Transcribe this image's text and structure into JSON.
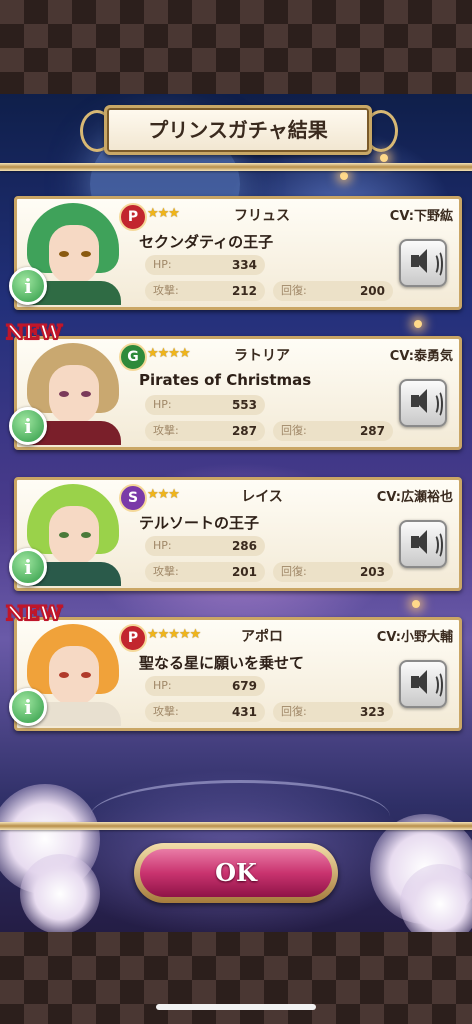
{
  "header": {
    "title": "プリンスガチャ結果"
  },
  "cards": [
    {
      "name": "フリュス",
      "cv": "CV:下野紘",
      "title": "セクンダティの王子",
      "rarity_letter": "P",
      "rarity_color": "#c2262e",
      "stars": "★★★",
      "new": "",
      "hp_label": "HP:",
      "hp": "334",
      "atk_label": "攻撃:",
      "atk": "212",
      "heal_label": "回復:",
      "heal": "200",
      "hair": "#3fa25a",
      "coat": "#2f6b44"
    },
    {
      "name": "ラトリア",
      "cv": "CV:泰勇気",
      "title": "Pirates of Christmas",
      "rarity_letter": "G",
      "rarity_color": "#2f8a3a",
      "stars": "★★★★",
      "new": "NEW",
      "hp_label": "HP:",
      "hp": "553",
      "atk_label": "攻撃:",
      "atk": "287",
      "heal_label": "回復:",
      "heal": "287",
      "hair": "#c9a870",
      "coat": "#7a1f2a"
    },
    {
      "name": "レイス",
      "cv": "CV:広瀬裕也",
      "title": "テルソートの王子",
      "rarity_letter": "S",
      "rarity_color": "#7a3aa8",
      "stars": "★★★",
      "new": "",
      "hp_label": "HP:",
      "hp": "286",
      "atk_label": "攻撃:",
      "atk": "201",
      "heal_label": "回復:",
      "heal": "203",
      "hair": "#9ad24a",
      "coat": "#2a5a4a"
    },
    {
      "name": "アポロ",
      "cv": "CV:小野大輔",
      "title": "聖なる星に願いを乗せて",
      "rarity_letter": "P",
      "rarity_color": "#c2262e",
      "stars": "★★★★★",
      "new": "NEW",
      "hp_label": "HP:",
      "hp": "679",
      "atk_label": "攻撃:",
      "atk": "431",
      "heal_label": "回復:",
      "heal": "323",
      "hair": "#f0a23a",
      "coat": "#e8e0d0"
    }
  ],
  "footer": {
    "ok_label": "OK"
  },
  "icons": {
    "info": "i",
    "sound": "speaker-icon"
  }
}
